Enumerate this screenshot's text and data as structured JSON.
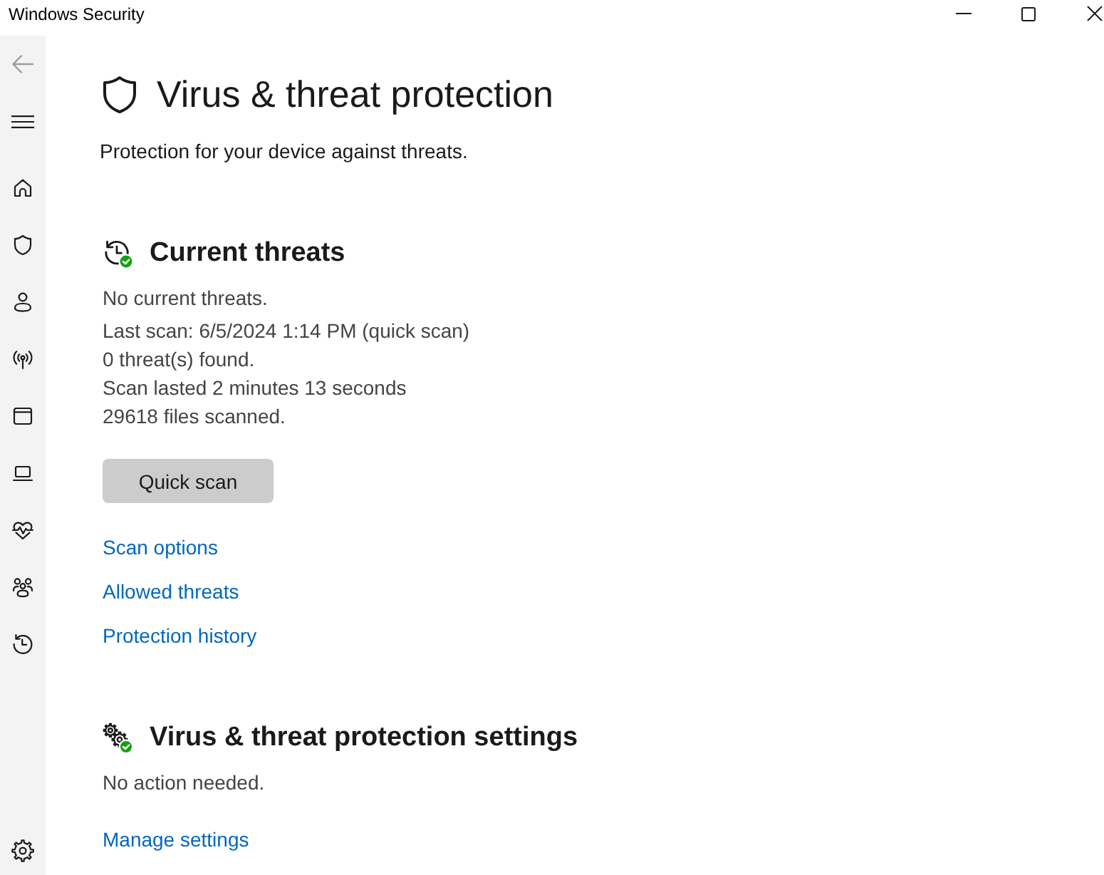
{
  "window": {
    "title": "Windows Security"
  },
  "back_button": {
    "disabled": true
  },
  "page": {
    "title": "Virus & threat protection",
    "subtitle": "Protection for your device against threats."
  },
  "sections": [
    {
      "kind": "threats",
      "heading": "Current threats",
      "status": "No current threats.",
      "details": [
        "Last scan: 6/5/2024 1:14 PM (quick scan)",
        "0 threat(s) found.",
        "Scan lasted 2 minutes 13 seconds",
        "29618 files scanned."
      ],
      "button": "Quick scan",
      "links": [
        "Scan options",
        "Allowed threats",
        "Protection history"
      ]
    },
    {
      "kind": "settings",
      "heading": "Virus & threat protection settings",
      "status": "No action needed.",
      "links": [
        "Manage settings"
      ]
    }
  ]
}
